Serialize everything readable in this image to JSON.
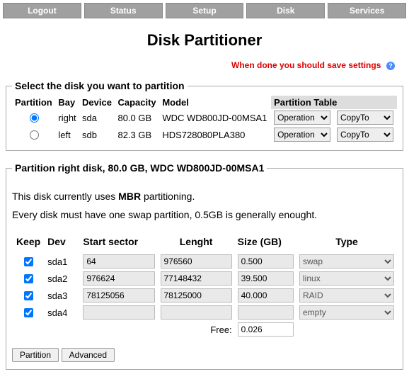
{
  "nav": [
    "Logout",
    "Status",
    "Setup",
    "Disk",
    "Services"
  ],
  "page_title": "Disk Partitioner",
  "warning": "When done you should save settings",
  "disk_select": {
    "legend": "Select the disk you want to partition",
    "headers": {
      "partition": "Partition",
      "bay": "Bay",
      "device": "Device",
      "capacity": "Capacity",
      "model": "Model",
      "pt": "Partition Table"
    },
    "operation_label": "Operation",
    "copyto_label": "CopyTo",
    "rows": [
      {
        "selected": true,
        "bay": "right",
        "device": "sda",
        "capacity": "80.0 GB",
        "model": "WDC WD800JD-00MSA1"
      },
      {
        "selected": false,
        "bay": "left",
        "device": "sdb",
        "capacity": "82.3 GB",
        "model": "HDS728080PLA380"
      }
    ]
  },
  "partitions": {
    "legend": "Partition right disk, 80.0 GB, WDC WD800JD-00MSA1",
    "scheme_pre": "This disk currently uses ",
    "scheme": "MBR",
    "scheme_post": " partitioning.",
    "swap_note": "Every disk must have one swap partition, 0.5GB is generally enought.",
    "headers": {
      "keep": "Keep",
      "dev": "Dev",
      "start": "Start sector",
      "len": "Lenght",
      "size": "Size (GB)",
      "type": "Type"
    },
    "rows": [
      {
        "keep": true,
        "dev": "sda1",
        "start": "64",
        "len": "976560",
        "size": "0.500",
        "type": "swap"
      },
      {
        "keep": true,
        "dev": "sda2",
        "start": "976624",
        "len": "77148432",
        "size": "39.500",
        "type": "linux"
      },
      {
        "keep": true,
        "dev": "sda3",
        "start": "78125056",
        "len": "78125000",
        "size": "40.000",
        "type": "RAID"
      },
      {
        "keep": true,
        "dev": "sda4",
        "start": "",
        "len": "",
        "size": "",
        "type": "empty"
      }
    ],
    "free_label": "Free:",
    "free_value": "0.026",
    "buttons": {
      "partition": "Partition",
      "advanced": "Advanced"
    }
  }
}
